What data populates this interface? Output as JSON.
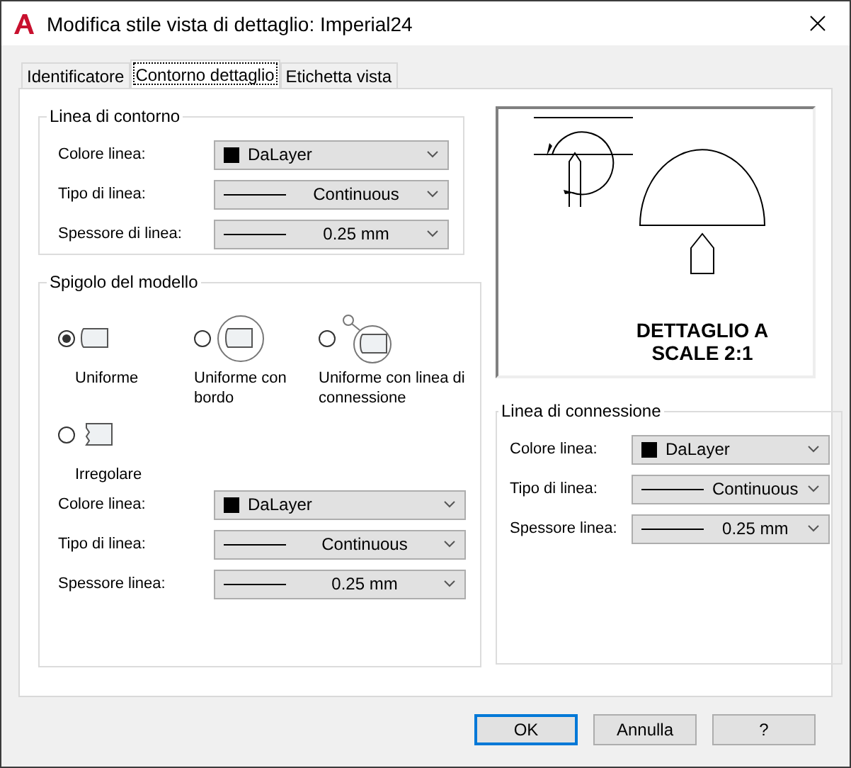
{
  "window": {
    "title": "Modifica stile vista di dettaglio: Imperial24"
  },
  "tabs": [
    {
      "label": "Identificatore",
      "selected": false
    },
    {
      "label": "Contorno dettaglio",
      "selected": true
    },
    {
      "label": "Etichetta vista",
      "selected": false
    }
  ],
  "boundary_group": {
    "title": "Linea di contorno",
    "fields": [
      {
        "label": "Colore linea:",
        "kind": "color",
        "value": "DaLayer"
      },
      {
        "label": "Tipo di linea:",
        "kind": "line",
        "value": "Continuous"
      },
      {
        "label": "Spessore di linea:",
        "kind": "line",
        "value": "0.25 mm"
      }
    ]
  },
  "model_edge_group": {
    "title": "Spigolo del modello",
    "options": [
      {
        "label": "Uniforme",
        "kind": "smooth",
        "selected": true
      },
      {
        "label": "Uniforme con bordo",
        "kind": "smooth_border",
        "selected": false
      },
      {
        "label": "Uniforme con linea di connessione",
        "kind": "smooth_connection",
        "selected": false
      },
      {
        "label": "Irregolare",
        "kind": "jagged",
        "selected": false
      }
    ],
    "fields": [
      {
        "label": "Colore linea:",
        "kind": "color",
        "value": "DaLayer"
      },
      {
        "label": "Tipo di linea:",
        "kind": "line",
        "value": "Continuous"
      },
      {
        "label": "Spessore linea:",
        "kind": "line",
        "value": "0.25 mm"
      }
    ]
  },
  "preview": {
    "caption": [
      "DETTAGLIO A",
      "SCALE 2:1"
    ]
  },
  "connection_group": {
    "title": "Linea di connessione",
    "fields": [
      {
        "label": "Colore linea:",
        "kind": "color",
        "value": "DaLayer"
      },
      {
        "label": "Tipo di linea:",
        "kind": "line",
        "value": "Continuous"
      },
      {
        "label": "Spessore linea:",
        "kind": "line",
        "value": "0.25 mm"
      }
    ]
  },
  "buttons": [
    {
      "label": "OK",
      "default": true
    },
    {
      "label": "Annulla",
      "default": false
    },
    {
      "label": "?",
      "default": false
    }
  ]
}
